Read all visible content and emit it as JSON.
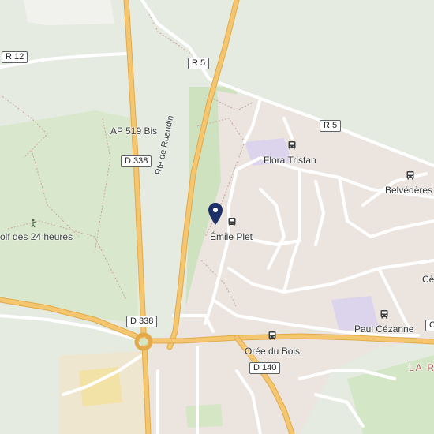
{
  "map": {
    "road_shields": {
      "r12": "R 12",
      "r5_top": "R 5",
      "r5_right": "R 5",
      "d338_upper": "D 338",
      "d338_lower": "D 338",
      "d140": "D 140",
      "c_right": "C"
    },
    "labels": {
      "ap519": "AP 519 Bis",
      "route_ruaudin": "Rte de Ruaudin",
      "golf": "olf des 24 heures",
      "flora_tristan": "Flora Tristan",
      "belvederes": "Belvédères",
      "emile_plet": "Émile Plet",
      "ce": "Cè",
      "paul_cezanne": "Paul Cézanne",
      "oree_du_bois": "Orée du Bois",
      "la_r": "LA R"
    },
    "transit_stops": [
      "Flora Tristan",
      "Belvédères",
      "Émile Plet",
      "Paul Cézanne",
      "Orée du Bois"
    ],
    "selected_location": "Émile Plet",
    "colors": {
      "background": "#e8eae3",
      "park": "#d9e8cc",
      "forest": "#cfe2c0",
      "urban": "#e9e3df",
      "main_road": "#f5c670",
      "main_road_edge": "#e2aa4b",
      "minor_road": "#ffffff",
      "transit_area": "#dcd4ec",
      "pin": "#1d3168"
    }
  }
}
